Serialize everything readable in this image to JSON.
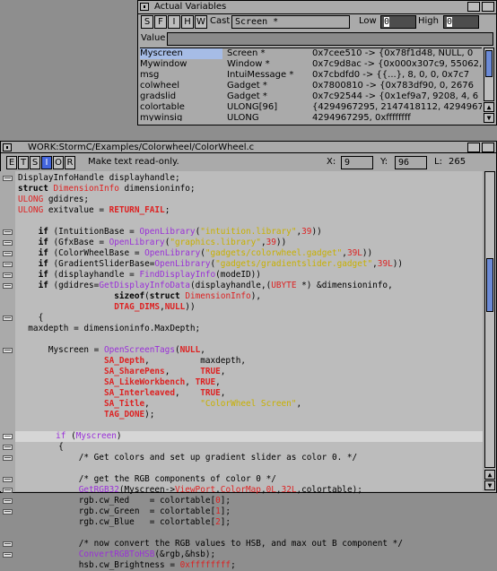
{
  "vars_window": {
    "title": "Actual Variables",
    "buttons": [
      "S",
      "F",
      "I",
      "H",
      "W"
    ],
    "cast_label": "Cast",
    "cast_value": "Screen *",
    "low_label": "Low",
    "low_value": "0",
    "high_label": "High",
    "high_value": "0",
    "value_label": "Value",
    "names": [
      "Myscreen",
      "Mywindow",
      "msg",
      "colwheel",
      "gradslid",
      "colortable",
      "mywinsig"
    ],
    "types": [
      "Screen *",
      "Window *",
      "IntuiMessage *",
      "Gadget *",
      "Gadget *",
      "ULONG[96]",
      "ULONG"
    ],
    "values": [
      "0x7cee510 -> {0x78f1d48, NULL, 0",
      "0x7c9d8ac -> {0x000x307c9, 55062, 0",
      "0x7cbdfd0 -> {{...}, 8, 0, 0, 0x7c7",
      "0x7800810 -> {0x783df90, 0, 2676",
      "0x7c92544 -> {0x1ef9a7, 9208, 4, 6",
      "{4294967295, 2147418112, 42949672",
      "4294967295, 0xffffffff"
    ]
  },
  "editor_window": {
    "title": "WORK:StormC/Examples/Colorwheel/ColorWheel.c",
    "tool_buttons": [
      "E",
      "T",
      "S",
      "I",
      "O",
      "R"
    ],
    "status_text": "Make text read-only.",
    "x_label": "X:",
    "x_value": "9",
    "y_label": "Y:",
    "y_value": "96",
    "l_label": "L:",
    "l_value": "265"
  },
  "code_lines": [
    [
      {
        "t": "DisplayInfoHandle displayhandle;"
      }
    ],
    [
      {
        "t": "struct",
        "c": "k"
      },
      {
        "t": " "
      },
      {
        "t": "DimensionInfo",
        "c": "m"
      },
      {
        "t": " dimensioninfo;"
      }
    ],
    [
      {
        "t": "ULONG",
        "c": "m"
      },
      {
        "t": " gdidres;"
      }
    ],
    [
      {
        "t": "ULONG",
        "c": "m"
      },
      {
        "t": " exitvalue = "
      },
      {
        "t": "RETURN_FAIL",
        "c": "b"
      },
      {
        "t": ";"
      }
    ],
    [
      {
        "t": ""
      }
    ],
    [
      {
        "t": "    "
      },
      {
        "t": "if",
        "c": "k"
      },
      {
        "t": " (IntuitionBase = "
      },
      {
        "t": "OpenLibrary",
        "c": "f"
      },
      {
        "t": "("
      },
      {
        "t": "\"intuition.library\"",
        "c": "s"
      },
      {
        "t": ","
      },
      {
        "t": "39",
        "c": "m"
      },
      {
        "t": "))"
      }
    ],
    [
      {
        "t": "    "
      },
      {
        "t": "if",
        "c": "k"
      },
      {
        "t": " (GfxBase = "
      },
      {
        "t": "OpenLibrary",
        "c": "f"
      },
      {
        "t": "("
      },
      {
        "t": "\"graphics.library\"",
        "c": "s"
      },
      {
        "t": ","
      },
      {
        "t": "39",
        "c": "m"
      },
      {
        "t": "))"
      }
    ],
    [
      {
        "t": "    "
      },
      {
        "t": "if",
        "c": "k"
      },
      {
        "t": " (ColorWheelBase = "
      },
      {
        "t": "OpenLibrary",
        "c": "f"
      },
      {
        "t": "("
      },
      {
        "t": "\"gadgets/colorwheel.gadget\"",
        "c": "s"
      },
      {
        "t": ","
      },
      {
        "t": "39L",
        "c": "m"
      },
      {
        "t": "))"
      }
    ],
    [
      {
        "t": "    "
      },
      {
        "t": "if",
        "c": "k"
      },
      {
        "t": " (GradientSliderBase="
      },
      {
        "t": "OpenLibrary",
        "c": "f"
      },
      {
        "t": "("
      },
      {
        "t": "\"gadgets/gradientslider.gadget\"",
        "c": "s"
      },
      {
        "t": ","
      },
      {
        "t": "39L",
        "c": "m"
      },
      {
        "t": "))"
      }
    ],
    [
      {
        "t": "    "
      },
      {
        "t": "if",
        "c": "k"
      },
      {
        "t": " (displayhandle = "
      },
      {
        "t": "FindDisplayInfo",
        "c": "f"
      },
      {
        "t": "(modeID))"
      }
    ],
    [
      {
        "t": "    "
      },
      {
        "t": "if",
        "c": "k"
      },
      {
        "t": " (gdidres="
      },
      {
        "t": "GetDisplayInfoData",
        "c": "f"
      },
      {
        "t": "(displayhandle,("
      },
      {
        "t": "UBYTE",
        "c": "m"
      },
      {
        "t": " *) &dimensioninfo,"
      }
    ],
    [
      {
        "t": "                   "
      },
      {
        "t": "sizeof",
        "c": "k"
      },
      {
        "t": "("
      },
      {
        "t": "struct",
        "c": "k"
      },
      {
        "t": " "
      },
      {
        "t": "DimensionInfo",
        "c": "m"
      },
      {
        "t": "),"
      }
    ],
    [
      {
        "t": "                   "
      },
      {
        "t": "DTAG_DIMS",
        "c": "b"
      },
      {
        "t": ","
      },
      {
        "t": "NULL",
        "c": "b"
      },
      {
        "t": "))"
      }
    ],
    [
      {
        "t": "    {"
      }
    ],
    [
      {
        "t": "  maxdepth = dimensioninfo.MaxDepth;"
      }
    ],
    [
      {
        "t": ""
      }
    ],
    [
      {
        "t": "      Myscreen = "
      },
      {
        "t": "OpenScreenTags",
        "c": "f"
      },
      {
        "t": "("
      },
      {
        "t": "NULL",
        "c": "b"
      },
      {
        "t": ","
      }
    ],
    [
      {
        "t": "                 "
      },
      {
        "t": "SA_Depth",
        "c": "b"
      },
      {
        "t": ",          maxdepth,"
      }
    ],
    [
      {
        "t": "                 "
      },
      {
        "t": "SA_SharePens",
        "c": "b"
      },
      {
        "t": ",      "
      },
      {
        "t": "TRUE",
        "c": "b"
      },
      {
        "t": ","
      }
    ],
    [
      {
        "t": "                 "
      },
      {
        "t": "SA_LikeWorkbench",
        "c": "b"
      },
      {
        "t": ", "
      },
      {
        "t": "TRUE",
        "c": "b"
      },
      {
        "t": ","
      }
    ],
    [
      {
        "t": "                 "
      },
      {
        "t": "SA_Interleaved",
        "c": "b"
      },
      {
        "t": ",    "
      },
      {
        "t": "TRUE",
        "c": "b"
      },
      {
        "t": ","
      }
    ],
    [
      {
        "t": "                 "
      },
      {
        "t": "SA_Title",
        "c": "b"
      },
      {
        "t": ",          "
      },
      {
        "t": "\"ColorWheel Screen\"",
        "c": "s"
      },
      {
        "t": ","
      }
    ],
    [
      {
        "t": "                 "
      },
      {
        "t": "TAG_DONE",
        "c": "b"
      },
      {
        "t": ");"
      }
    ],
    [
      {
        "t": ""
      }
    ],
    [
      {
        "t": "        "
      },
      {
        "t": "if",
        "c": "f"
      },
      {
        "t": " ("
      },
      {
        "t": "Myscreen",
        "c": "f"
      },
      {
        "t": ")"
      }
    ],
    [
      {
        "t": "        {"
      }
    ],
    [
      {
        "t": "            /* Get colors and set up gradient slider as color 0. */"
      }
    ],
    [
      {
        "t": ""
      }
    ],
    [
      {
        "t": "            /* get the RGB components of color 0 */"
      }
    ],
    [
      {
        "t": "            "
      },
      {
        "t": "GetRGB32",
        "c": "f"
      },
      {
        "t": "(Myscreen->"
      },
      {
        "t": "ViewPort",
        "c": "m"
      },
      {
        "t": "."
      },
      {
        "t": "ColorMap",
        "c": "m"
      },
      {
        "t": ","
      },
      {
        "t": "0L",
        "c": "m"
      },
      {
        "t": ","
      },
      {
        "t": "32L",
        "c": "m"
      },
      {
        "t": ",colortable);"
      }
    ],
    [
      {
        "t": "            rgb.cw_Red    = colortable["
      },
      {
        "t": "0",
        "c": "m"
      },
      {
        "t": "];"
      }
    ],
    [
      {
        "t": "            rgb.cw_Green  = colortable["
      },
      {
        "t": "1",
        "c": "m"
      },
      {
        "t": "];"
      }
    ],
    [
      {
        "t": "            rgb.cw_Blue   = colortable["
      },
      {
        "t": "2",
        "c": "m"
      },
      {
        "t": "];"
      }
    ],
    [
      {
        "t": ""
      }
    ],
    [
      {
        "t": "            /* now convert the RGB values to HSB, and max out B component */"
      }
    ],
    [
      {
        "t": "            "
      },
      {
        "t": "ConvertRGBToHSB",
        "c": "f"
      },
      {
        "t": "(&rgb,&hsb);"
      }
    ],
    [
      {
        "t": "            hsb.cw_Brightness = "
      },
      {
        "t": "0xffffffff",
        "c": "m"
      },
      {
        "t": ";"
      }
    ]
  ]
}
